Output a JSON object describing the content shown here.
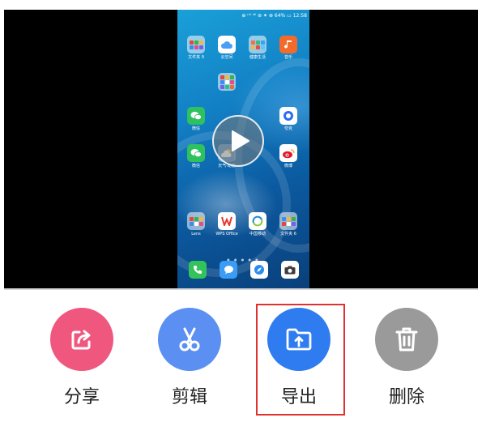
{
  "colors": {
    "share": "#f0577e",
    "edit": "#5b8ff2",
    "export": "#2f7cf0",
    "delete": "#9a9a9a",
    "highlight": "#e03030"
  },
  "phone": {
    "status_bar": "⊕ ⁿᴵˡ ⁿᴵˡ ⊛ ⁕ ⊗ 64% ▭ 12:58",
    "apps": [
      {
        "label": "文件夹 9",
        "icon": "folder-icon",
        "color": "#ffffff"
      },
      {
        "label": "云空间",
        "icon": "cloud-icon",
        "color": "#4a9ef5"
      },
      {
        "label": "健康生活",
        "icon": "health-icon",
        "color": "#ffffff"
      },
      {
        "label": "音乐",
        "icon": "music-icon",
        "color": "#f26b2a"
      },
      {
        "label": "",
        "icon": "folder-icon",
        "color": "#ffffff"
      },
      {
        "label": "微信",
        "icon": "wechat-icon",
        "color": "#2dc160"
      },
      {
        "label": "夸克",
        "icon": "quark-icon",
        "color": "#2b6cf0"
      },
      {
        "label": "微信",
        "icon": "wechat-icon",
        "color": "#2dc160"
      },
      {
        "label": "天气·动态",
        "icon": "weather-icon",
        "color": "#f5c542"
      },
      {
        "label": "微博",
        "icon": "weibo-icon",
        "color": "#f2a62a"
      },
      {
        "label": "Lens",
        "icon": "folder-icon",
        "color": "#ffffff"
      },
      {
        "label": "WPS Office",
        "icon": "wps-icon",
        "color": "#e8372f"
      },
      {
        "label": "中国移动",
        "icon": "china-mobile-icon",
        "color": "#1a8ad6"
      },
      {
        "label": "文件夹 6",
        "icon": "folder-icon",
        "color": "#ffffff"
      }
    ],
    "dock": [
      {
        "icon": "phone-call-icon",
        "color": "#33c35a"
      },
      {
        "icon": "message-icon",
        "color": "#3a9cf5"
      },
      {
        "icon": "browser-icon",
        "color": "#2a8cf0"
      },
      {
        "icon": "camera-icon",
        "color": "#3d3d3d"
      }
    ]
  },
  "actions": [
    {
      "id": "share",
      "label": "分享",
      "icon": "share-icon"
    },
    {
      "id": "edit",
      "label": "剪辑",
      "icon": "scissors-icon"
    },
    {
      "id": "export",
      "label": "导出",
      "icon": "export-folder-icon"
    },
    {
      "id": "delete",
      "label": "删除",
      "icon": "trash-icon"
    }
  ]
}
